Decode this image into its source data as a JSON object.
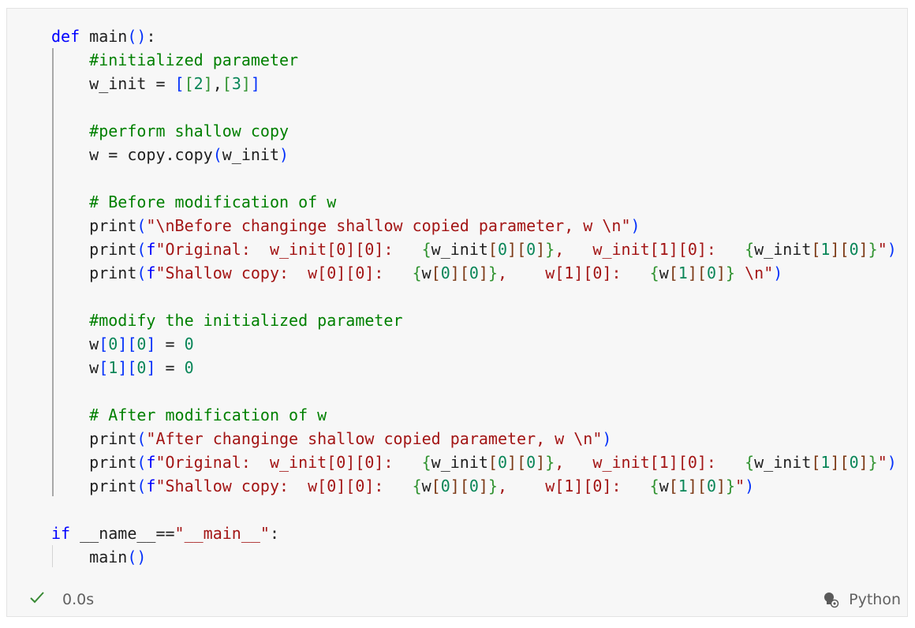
{
  "code_lines": [
    [
      {
        "t": "def ",
        "c": "kw"
      },
      {
        "t": "main",
        "c": "fn"
      },
      {
        "t": "()",
        "c": "br1"
      },
      {
        "t": ":",
        "c": "id"
      }
    ],
    [
      {
        "t": "    #initialized parameter",
        "c": "com"
      }
    ],
    [
      {
        "t": "    w_init = ",
        "c": "id"
      },
      {
        "t": "[",
        "c": "br1"
      },
      {
        "t": "[",
        "c": "br2"
      },
      {
        "t": "2",
        "c": "num"
      },
      {
        "t": "]",
        "c": "br2"
      },
      {
        "t": ",",
        "c": "id"
      },
      {
        "t": "[",
        "c": "br2"
      },
      {
        "t": "3",
        "c": "num"
      },
      {
        "t": "]",
        "c": "br2"
      },
      {
        "t": "]",
        "c": "br1"
      }
    ],
    [],
    [
      {
        "t": "    #perform shallow copy",
        "c": "com"
      }
    ],
    [
      {
        "t": "    w = copy.copy",
        "c": "id"
      },
      {
        "t": "(",
        "c": "br1"
      },
      {
        "t": "w_init",
        "c": "id"
      },
      {
        "t": ")",
        "c": "br1"
      }
    ],
    [],
    [
      {
        "t": "    # Before modification of w",
        "c": "com"
      }
    ],
    [
      {
        "t": "    print",
        "c": "id"
      },
      {
        "t": "(",
        "c": "br1"
      },
      {
        "t": "\"\\nBefore changinge shallow copied parameter, w \\n\"",
        "c": "str"
      },
      {
        "t": ")",
        "c": "br1"
      }
    ],
    [
      {
        "t": "    print",
        "c": "id"
      },
      {
        "t": "(",
        "c": "br1"
      },
      {
        "t": "f",
        "c": "kw"
      },
      {
        "t": "\"Original:  w_init[0][0]:   ",
        "c": "str"
      },
      {
        "t": "{",
        "c": "br2"
      },
      {
        "t": "w_init",
        "c": "id"
      },
      {
        "t": "[",
        "c": "br3"
      },
      {
        "t": "0",
        "c": "num"
      },
      {
        "t": "]",
        "c": "br3"
      },
      {
        "t": "[",
        "c": "br3"
      },
      {
        "t": "0",
        "c": "num"
      },
      {
        "t": "]",
        "c": "br3"
      },
      {
        "t": "}",
        "c": "br2"
      },
      {
        "t": ",   w_init[1][0]:   ",
        "c": "str"
      },
      {
        "t": "{",
        "c": "br2"
      },
      {
        "t": "w_init",
        "c": "id"
      },
      {
        "t": "[",
        "c": "br3"
      },
      {
        "t": "1",
        "c": "num"
      },
      {
        "t": "]",
        "c": "br3"
      },
      {
        "t": "[",
        "c": "br3"
      },
      {
        "t": "0",
        "c": "num"
      },
      {
        "t": "]",
        "c": "br3"
      },
      {
        "t": "}",
        "c": "br2"
      },
      {
        "t": "\"",
        "c": "str"
      },
      {
        "t": ")",
        "c": "br1"
      }
    ],
    [
      {
        "t": "    print",
        "c": "id"
      },
      {
        "t": "(",
        "c": "br1"
      },
      {
        "t": "f",
        "c": "kw"
      },
      {
        "t": "\"Shallow copy:  w[0][0]:   ",
        "c": "str"
      },
      {
        "t": "{",
        "c": "br2"
      },
      {
        "t": "w",
        "c": "id"
      },
      {
        "t": "[",
        "c": "br3"
      },
      {
        "t": "0",
        "c": "num"
      },
      {
        "t": "]",
        "c": "br3"
      },
      {
        "t": "[",
        "c": "br3"
      },
      {
        "t": "0",
        "c": "num"
      },
      {
        "t": "]",
        "c": "br3"
      },
      {
        "t": "}",
        "c": "br2"
      },
      {
        "t": ",    w[1][0]:   ",
        "c": "str"
      },
      {
        "t": "{",
        "c": "br2"
      },
      {
        "t": "w",
        "c": "id"
      },
      {
        "t": "[",
        "c": "br3"
      },
      {
        "t": "1",
        "c": "num"
      },
      {
        "t": "]",
        "c": "br3"
      },
      {
        "t": "[",
        "c": "br3"
      },
      {
        "t": "0",
        "c": "num"
      },
      {
        "t": "]",
        "c": "br3"
      },
      {
        "t": "}",
        "c": "br2"
      },
      {
        "t": " \\n\"",
        "c": "str"
      },
      {
        "t": ")",
        "c": "br1"
      }
    ],
    [],
    [
      {
        "t": "    #modify the initialized parameter",
        "c": "com"
      }
    ],
    [
      {
        "t": "    w",
        "c": "id"
      },
      {
        "t": "[",
        "c": "br1"
      },
      {
        "t": "0",
        "c": "num"
      },
      {
        "t": "]",
        "c": "br1"
      },
      {
        "t": "[",
        "c": "br1"
      },
      {
        "t": "0",
        "c": "num"
      },
      {
        "t": "]",
        "c": "br1"
      },
      {
        "t": " = ",
        "c": "id"
      },
      {
        "t": "0",
        "c": "num"
      }
    ],
    [
      {
        "t": "    w",
        "c": "id"
      },
      {
        "t": "[",
        "c": "br1"
      },
      {
        "t": "1",
        "c": "num"
      },
      {
        "t": "]",
        "c": "br1"
      },
      {
        "t": "[",
        "c": "br1"
      },
      {
        "t": "0",
        "c": "num"
      },
      {
        "t": "]",
        "c": "br1"
      },
      {
        "t": " = ",
        "c": "id"
      },
      {
        "t": "0",
        "c": "num"
      }
    ],
    [],
    [
      {
        "t": "    # After modification of w",
        "c": "com"
      }
    ],
    [
      {
        "t": "    print",
        "c": "id"
      },
      {
        "t": "(",
        "c": "br1"
      },
      {
        "t": "\"After changinge shallow copied parameter, w \\n\"",
        "c": "str"
      },
      {
        "t": ")",
        "c": "br1"
      }
    ],
    [
      {
        "t": "    print",
        "c": "id"
      },
      {
        "t": "(",
        "c": "br1"
      },
      {
        "t": "f",
        "c": "kw"
      },
      {
        "t": "\"Original:  w_init[0][0]:   ",
        "c": "str"
      },
      {
        "t": "{",
        "c": "br2"
      },
      {
        "t": "w_init",
        "c": "id"
      },
      {
        "t": "[",
        "c": "br3"
      },
      {
        "t": "0",
        "c": "num"
      },
      {
        "t": "]",
        "c": "br3"
      },
      {
        "t": "[",
        "c": "br3"
      },
      {
        "t": "0",
        "c": "num"
      },
      {
        "t": "]",
        "c": "br3"
      },
      {
        "t": "}",
        "c": "br2"
      },
      {
        "t": ",   w_init[1][0]:   ",
        "c": "str"
      },
      {
        "t": "{",
        "c": "br2"
      },
      {
        "t": "w_init",
        "c": "id"
      },
      {
        "t": "[",
        "c": "br3"
      },
      {
        "t": "1",
        "c": "num"
      },
      {
        "t": "]",
        "c": "br3"
      },
      {
        "t": "[",
        "c": "br3"
      },
      {
        "t": "0",
        "c": "num"
      },
      {
        "t": "]",
        "c": "br3"
      },
      {
        "t": "}",
        "c": "br2"
      },
      {
        "t": "\"",
        "c": "str"
      },
      {
        "t": ")",
        "c": "br1"
      }
    ],
    [
      {
        "t": "    print",
        "c": "id"
      },
      {
        "t": "(",
        "c": "br1"
      },
      {
        "t": "f",
        "c": "kw"
      },
      {
        "t": "\"Shallow copy:  w[0][0]:   ",
        "c": "str"
      },
      {
        "t": "{",
        "c": "br2"
      },
      {
        "t": "w",
        "c": "id"
      },
      {
        "t": "[",
        "c": "br3"
      },
      {
        "t": "0",
        "c": "num"
      },
      {
        "t": "]",
        "c": "br3"
      },
      {
        "t": "[",
        "c": "br3"
      },
      {
        "t": "0",
        "c": "num"
      },
      {
        "t": "]",
        "c": "br3"
      },
      {
        "t": "}",
        "c": "br2"
      },
      {
        "t": ",    w[1][0]:   ",
        "c": "str"
      },
      {
        "t": "{",
        "c": "br2"
      },
      {
        "t": "w",
        "c": "id"
      },
      {
        "t": "[",
        "c": "br3"
      },
      {
        "t": "1",
        "c": "num"
      },
      {
        "t": "]",
        "c": "br3"
      },
      {
        "t": "[",
        "c": "br3"
      },
      {
        "t": "0",
        "c": "num"
      },
      {
        "t": "]",
        "c": "br3"
      },
      {
        "t": "}",
        "c": "br2"
      },
      {
        "t": "\"",
        "c": "str"
      },
      {
        "t": ")",
        "c": "br1"
      }
    ],
    [],
    [
      {
        "t": "if ",
        "c": "kw"
      },
      {
        "t": "__name__==",
        "c": "id"
      },
      {
        "t": "\"__main__\"",
        "c": "str"
      },
      {
        "t": ":",
        "c": "id"
      }
    ],
    [
      {
        "t": "    main",
        "c": "id"
      },
      {
        "t": "()",
        "c": "br1"
      }
    ]
  ],
  "status": {
    "check_icon": "check-icon",
    "exec_time": "0.0s",
    "kernel_icon": "kernel-icon",
    "kernel_name": "Python"
  },
  "colors": {
    "keyword": "#0000ff",
    "string": "#a31515",
    "comment": "#008000",
    "number": "#098658",
    "cell_background": "#f7f7f7",
    "check": "#388a34"
  }
}
